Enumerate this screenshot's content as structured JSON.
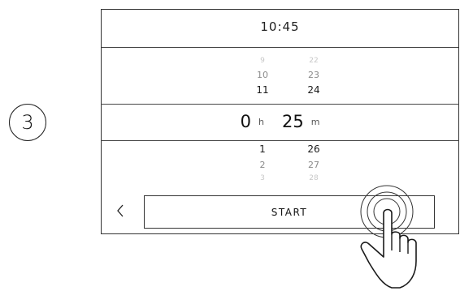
{
  "step": {
    "number": "3"
  },
  "screen": {
    "clock": "10:45",
    "hours": {
      "above": [
        "9",
        "10",
        "11"
      ],
      "selected": "0",
      "unit": "h",
      "below": [
        "1",
        "2",
        "3"
      ]
    },
    "minutes": {
      "above": [
        "22",
        "23",
        "24"
      ],
      "selected": "25",
      "unit": "m",
      "below": [
        "26",
        "27",
        "28"
      ]
    },
    "back_icon": "chevron-left-icon",
    "back_glyph": "<",
    "start_label": "START"
  },
  "overlay": {
    "icon": "tapping-hand-icon"
  }
}
